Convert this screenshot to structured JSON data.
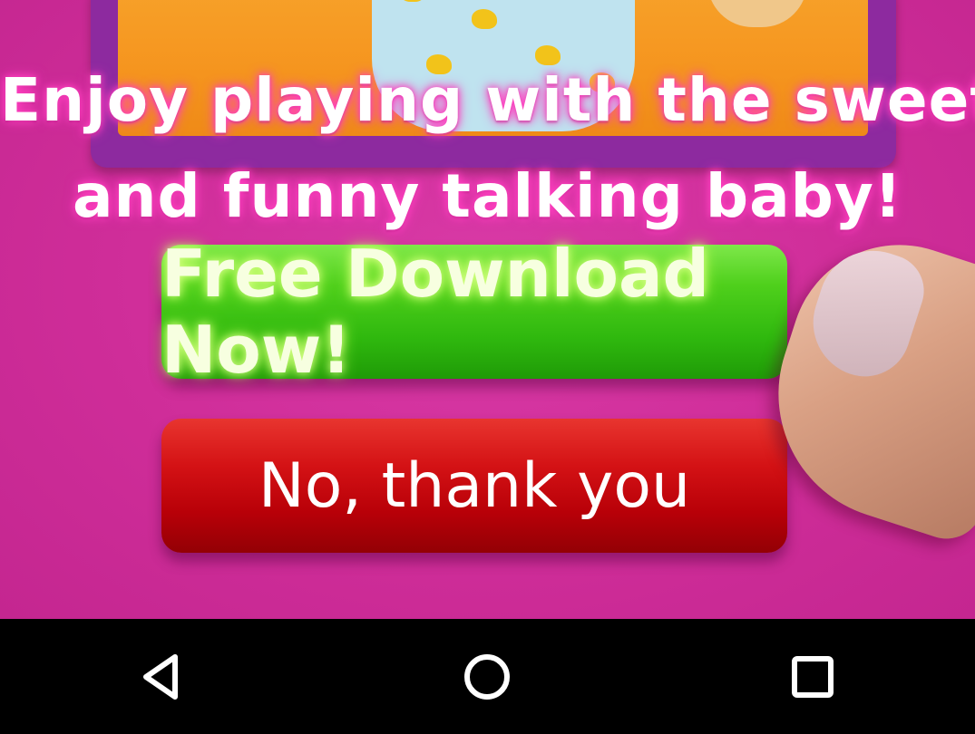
{
  "ad": {
    "headline_line1": "Enjoy playing with the sweet",
    "headline_line2": "and funny talking baby!",
    "download_button": "Free Download Now!",
    "cancel_button": "No, thank you",
    "colors": {
      "background": "#cf2d99",
      "download": "#3cc214",
      "cancel": "#c8000b",
      "frame": "#8d2a9f"
    }
  },
  "navbar": {
    "back_icon": "back-triangle-icon",
    "home_icon": "home-circle-icon",
    "recents_icon": "recents-square-icon"
  }
}
